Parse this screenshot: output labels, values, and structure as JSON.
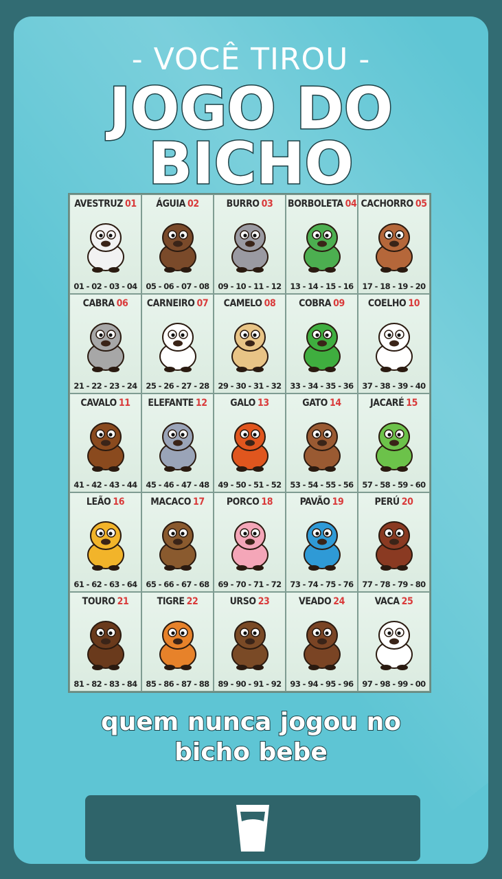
{
  "header": {
    "subtitle": "- VOCÊ TIROU -",
    "title_line1": "JOGO DO",
    "title_line2": "BICHO"
  },
  "board": {
    "cells": [
      {
        "name": "AVESTRUZ",
        "num": "01",
        "numbers": "01 - 02 - 03 - 04",
        "icon": "ostrich-icon",
        "color": "#f2f2f2"
      },
      {
        "name": "ÁGUIA",
        "num": "02",
        "numbers": "05 - 06 - 07 - 08",
        "icon": "eagle-icon",
        "color": "#7a4a2a"
      },
      {
        "name": "BURRO",
        "num": "03",
        "numbers": "09 - 10 - 11 - 12",
        "icon": "donkey-icon",
        "color": "#9a9aa2"
      },
      {
        "name": "BORBOLETA",
        "num": "04",
        "numbers": "13 - 14 - 15 - 16",
        "icon": "butterfly-icon",
        "color": "#4caf50"
      },
      {
        "name": "CACHORRO",
        "num": "05",
        "numbers": "17 - 18 - 19 - 20",
        "icon": "dog-icon",
        "color": "#b5673a"
      },
      {
        "name": "CABRA",
        "num": "06",
        "numbers": "21 - 22 - 23 - 24",
        "icon": "goat-icon",
        "color": "#a7a7a7"
      },
      {
        "name": "CARNEIRO",
        "num": "07",
        "numbers": "25 - 26 - 27 - 28",
        "icon": "sheep-icon",
        "color": "#ffffff"
      },
      {
        "name": "CAMELO",
        "num": "08",
        "numbers": "29 - 30 - 31 - 32",
        "icon": "camel-icon",
        "color": "#e8c486"
      },
      {
        "name": "COBRA",
        "num": "09",
        "numbers": "33 - 34 - 35 - 36",
        "icon": "snake-icon",
        "color": "#3fae3f"
      },
      {
        "name": "COELHO",
        "num": "10",
        "numbers": "37 - 38 - 39 - 40",
        "icon": "rabbit-icon",
        "color": "#ffffff"
      },
      {
        "name": "CAVALO",
        "num": "11",
        "numbers": "41 - 42 - 43 - 44",
        "icon": "horse-icon",
        "color": "#8a4a1e"
      },
      {
        "name": "ELEFANTE",
        "num": "12",
        "numbers": "45 - 46 - 47 - 48",
        "icon": "elephant-icon",
        "color": "#9aa4b8"
      },
      {
        "name": "GALO",
        "num": "13",
        "numbers": "49 - 50 - 51 - 52",
        "icon": "rooster-icon",
        "color": "#e0561e"
      },
      {
        "name": "GATO",
        "num": "14",
        "numbers": "53 - 54 - 55 - 56",
        "icon": "cat-icon",
        "color": "#9a5a32"
      },
      {
        "name": "JACARÉ",
        "num": "15",
        "numbers": "57 - 58 - 59 - 60",
        "icon": "alligator-icon",
        "color": "#6cc24a"
      },
      {
        "name": "LEÃO",
        "num": "16",
        "numbers": "61 - 62 - 63 - 64",
        "icon": "lion-icon",
        "color": "#f2b42a"
      },
      {
        "name": "MACACO",
        "num": "17",
        "numbers": "65 - 66 - 67 - 68",
        "icon": "monkey-icon",
        "color": "#8a5a2e"
      },
      {
        "name": "PORCO",
        "num": "18",
        "numbers": "69 - 70 - 71 - 72",
        "icon": "pig-icon",
        "color": "#f4a6b8"
      },
      {
        "name": "PAVÃO",
        "num": "19",
        "numbers": "73 - 74 - 75 - 76",
        "icon": "peacock-icon",
        "color": "#2f9ad6"
      },
      {
        "name": "PERÚ",
        "num": "20",
        "numbers": "77 - 78 - 79 - 80",
        "icon": "turkey-icon",
        "color": "#8a3a22"
      },
      {
        "name": "TOURO",
        "num": "21",
        "numbers": "81 - 82 - 83 - 84",
        "icon": "bull-icon",
        "color": "#6a3a1c"
      },
      {
        "name": "TIGRE",
        "num": "22",
        "numbers": "85 - 86 - 87 - 88",
        "icon": "tiger-icon",
        "color": "#e7822a"
      },
      {
        "name": "URSO",
        "num": "23",
        "numbers": "89 - 90 - 91 - 92",
        "icon": "bear-icon",
        "color": "#7a4a26"
      },
      {
        "name": "VEADO",
        "num": "24",
        "numbers": "93 - 94 - 95 - 96",
        "icon": "deer-icon",
        "color": "#7a4424"
      },
      {
        "name": "VACA",
        "num": "25",
        "numbers": "97 - 98 - 99 - 00",
        "icon": "cow-icon",
        "color": "#ffffff"
      }
    ]
  },
  "caption": {
    "line1": "quem nunca jogou no",
    "line2": "bicho bebe"
  },
  "drink_button": {
    "icon": "glass-icon"
  }
}
